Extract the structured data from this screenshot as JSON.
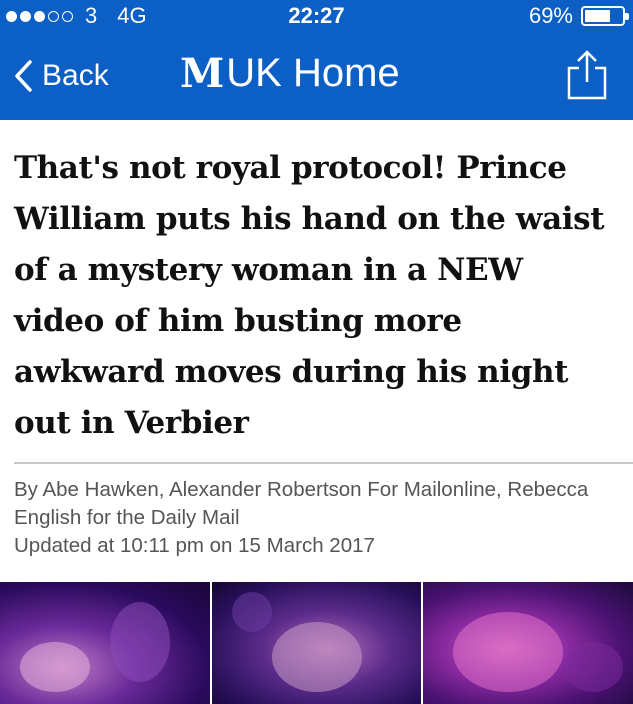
{
  "status_bar": {
    "carrier": "3",
    "network": "4G",
    "time": "22:27",
    "battery": "69%",
    "battery_level": 0.69
  },
  "nav": {
    "back_label": "Back",
    "logo": "M",
    "title": "UK Home"
  },
  "article": {
    "headline": "That's not royal protocol! Prince William puts his hand on the waist of a mystery woman in a NEW video of him busting more awkward moves during his night out in Verbier",
    "byline": "By Abe Hawken, Alexander Robertson For Mailonline, Rebecca English for the Daily Mail",
    "updated": "Updated at 10:11 pm on 15 March 2017"
  },
  "colors": {
    "brand_blue": "#0c5fc4"
  }
}
